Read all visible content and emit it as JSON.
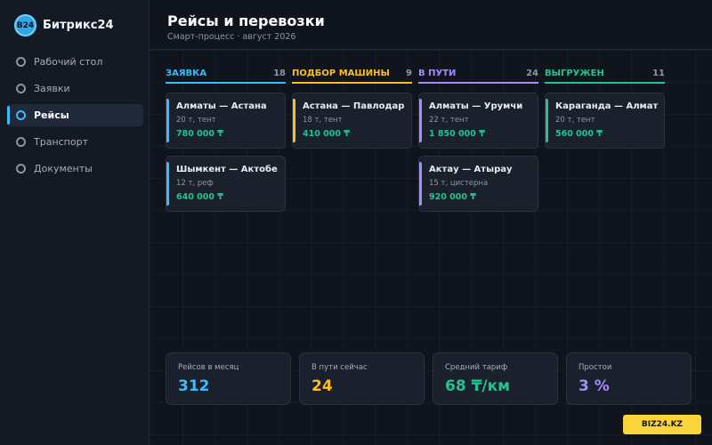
{
  "brand": {
    "logo": "B24",
    "name": "Битрикс24"
  },
  "sidebar": {
    "items": [
      {
        "label": "Рабочий стол",
        "icon": "circle-icon",
        "active": false
      },
      {
        "label": "Заявки",
        "icon": "circle-icon",
        "active": false
      },
      {
        "label": "Рейсы",
        "icon": "circle-icon",
        "active": true
      },
      {
        "label": "Транспорт",
        "icon": "circle-icon",
        "active": false
      },
      {
        "label": "Документы",
        "icon": "circle-icon",
        "active": false
      }
    ]
  },
  "header": {
    "title": "Рейсы и перевозки",
    "subtitle": "Смарт-процесс · август 2026"
  },
  "columns": [
    {
      "title": "ЗАЯВКА",
      "count": "18",
      "color": "#38bdf8",
      "cards": [
        {
          "route": "Алматы — Астана",
          "meta": "20 т, тент",
          "price": "780 000 ₸"
        },
        {
          "route": "Шымкент — Актобе",
          "meta": "12 т, реф",
          "price": "640 000 ₸"
        }
      ]
    },
    {
      "title": "ПОДБОР МАШИНЫ",
      "count": "9",
      "color": "#fbbf24",
      "cards": [
        {
          "route": "Астана — Павлодар",
          "meta": "18 т, тент",
          "price": "410 000 ₸"
        }
      ]
    },
    {
      "title": "В ПУТИ",
      "count": "24",
      "color": "#a78bfa",
      "cards": [
        {
          "route": "Алматы — Урумчи",
          "meta": "22 т, тент",
          "price": "1 850 000 ₸"
        },
        {
          "route": "Актау — Атырау",
          "meta": "15 т, цистерна",
          "price": "920 000 ₸"
        }
      ]
    },
    {
      "title": "ВЫГРУЖЕН",
      "count": "11",
      "color": "#22c38e",
      "cards": [
        {
          "route": "Караганда — Алмат",
          "meta": "20 т, тент",
          "price": "560 000 ₸"
        }
      ]
    }
  ],
  "stats": [
    {
      "label": "Рейсов в месяц",
      "value": "312",
      "color": "#38bdf8"
    },
    {
      "label": "В пути сейчас",
      "value": "24",
      "color": "#fbbf24"
    },
    {
      "label": "Средний тариф",
      "value": "68 ₸/км",
      "color": "#22c38e"
    },
    {
      "label": "Простои",
      "value": "3 %",
      "color": "#a78bfa"
    }
  ],
  "watermark": "BIZ24.KZ"
}
